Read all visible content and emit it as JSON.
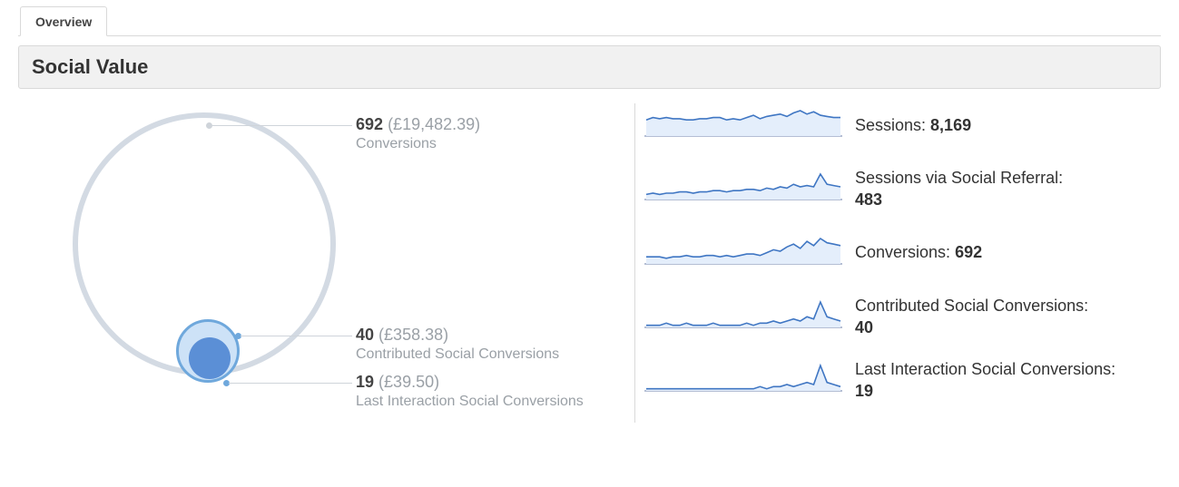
{
  "tab_label": "Overview",
  "panel_title": "Social Value",
  "diagram": {
    "conversions": {
      "number": "692",
      "money": "(£19,482.39)",
      "label": "Conversions"
    },
    "contributed": {
      "number": "40",
      "money": "(£358.38)",
      "label": "Contributed Social Conversions"
    },
    "last_interaction": {
      "number": "19",
      "money": "(£39.50)",
      "label": "Last Interaction Social Conversions"
    }
  },
  "metrics": [
    {
      "label": "Sessions:",
      "value": "8,169",
      "spark": [
        14,
        16,
        15,
        16,
        15,
        15,
        14,
        14,
        15,
        15,
        16,
        16,
        14,
        15,
        14,
        16,
        18,
        15,
        17,
        18,
        19,
        17,
        20,
        22,
        19,
        21,
        18,
        17,
        16,
        16
      ],
      "two_line": false
    },
    {
      "label": "Sessions via Social Referral:",
      "value": "483",
      "spark": [
        4,
        5,
        4,
        5,
        5,
        6,
        6,
        5,
        6,
        6,
        7,
        7,
        6,
        7,
        7,
        8,
        8,
        7,
        9,
        8,
        10,
        9,
        12,
        10,
        11,
        10,
        20,
        12,
        11,
        10
      ],
      "two_line": true
    },
    {
      "label": "Conversions:",
      "value": "692",
      "spark": [
        5,
        5,
        5,
        4,
        5,
        5,
        6,
        5,
        5,
        6,
        6,
        5,
        6,
        5,
        6,
        7,
        7,
        6,
        8,
        10,
        9,
        12,
        14,
        11,
        16,
        13,
        18,
        15,
        14,
        13
      ],
      "two_line": false
    },
    {
      "label": "Contributed Social Conversions:",
      "value": "40",
      "spark": [
        1,
        1,
        1,
        2,
        1,
        1,
        2,
        1,
        1,
        1,
        2,
        1,
        1,
        1,
        1,
        2,
        1,
        2,
        2,
        3,
        2,
        3,
        4,
        3,
        5,
        4,
        12,
        5,
        4,
        3
      ],
      "two_line": true
    },
    {
      "label": "Last Interaction Social Conversions:",
      "value": "19",
      "spark": [
        1,
        1,
        1,
        1,
        1,
        1,
        1,
        1,
        1,
        1,
        1,
        1,
        1,
        1,
        1,
        1,
        1,
        2,
        1,
        2,
        2,
        3,
        2,
        3,
        4,
        3,
        12,
        4,
        3,
        2
      ],
      "two_line": true
    }
  ],
  "chart_data": [
    {
      "type": "bubble-proportional",
      "title": "Social Value – conversion nesting",
      "series": [
        {
          "name": "Conversions",
          "value": 692,
          "money_gbp": 19482.39
        },
        {
          "name": "Contributed Social Conversions",
          "value": 40,
          "money_gbp": 358.38
        },
        {
          "name": "Last Interaction Social Conversions",
          "value": 19,
          "money_gbp": 39.5
        }
      ]
    },
    {
      "type": "sparkline",
      "title": "Sessions trend",
      "values": [
        14,
        16,
        15,
        16,
        15,
        15,
        14,
        14,
        15,
        15,
        16,
        16,
        14,
        15,
        14,
        16,
        18,
        15,
        17,
        18,
        19,
        17,
        20,
        22,
        19,
        21,
        18,
        17,
        16,
        16
      ]
    },
    {
      "type": "sparkline",
      "title": "Sessions via Social Referral trend",
      "values": [
        4,
        5,
        4,
        5,
        5,
        6,
        6,
        5,
        6,
        6,
        7,
        7,
        6,
        7,
        7,
        8,
        8,
        7,
        9,
        8,
        10,
        9,
        12,
        10,
        11,
        10,
        20,
        12,
        11,
        10
      ]
    },
    {
      "type": "sparkline",
      "title": "Conversions trend",
      "values": [
        5,
        5,
        5,
        4,
        5,
        5,
        6,
        5,
        5,
        6,
        6,
        5,
        6,
        5,
        6,
        7,
        7,
        6,
        8,
        10,
        9,
        12,
        14,
        11,
        16,
        13,
        18,
        15,
        14,
        13
      ]
    },
    {
      "type": "sparkline",
      "title": "Contributed Social Conversions trend",
      "values": [
        1,
        1,
        1,
        2,
        1,
        1,
        2,
        1,
        1,
        1,
        2,
        1,
        1,
        1,
        1,
        2,
        1,
        2,
        2,
        3,
        2,
        3,
        4,
        3,
        5,
        4,
        12,
        5,
        4,
        3
      ]
    },
    {
      "type": "sparkline",
      "title": "Last Interaction Social Conversions trend",
      "values": [
        1,
        1,
        1,
        1,
        1,
        1,
        1,
        1,
        1,
        1,
        1,
        1,
        1,
        1,
        1,
        1,
        1,
        2,
        1,
        2,
        2,
        3,
        2,
        3,
        4,
        3,
        12,
        4,
        3,
        2
      ]
    }
  ]
}
